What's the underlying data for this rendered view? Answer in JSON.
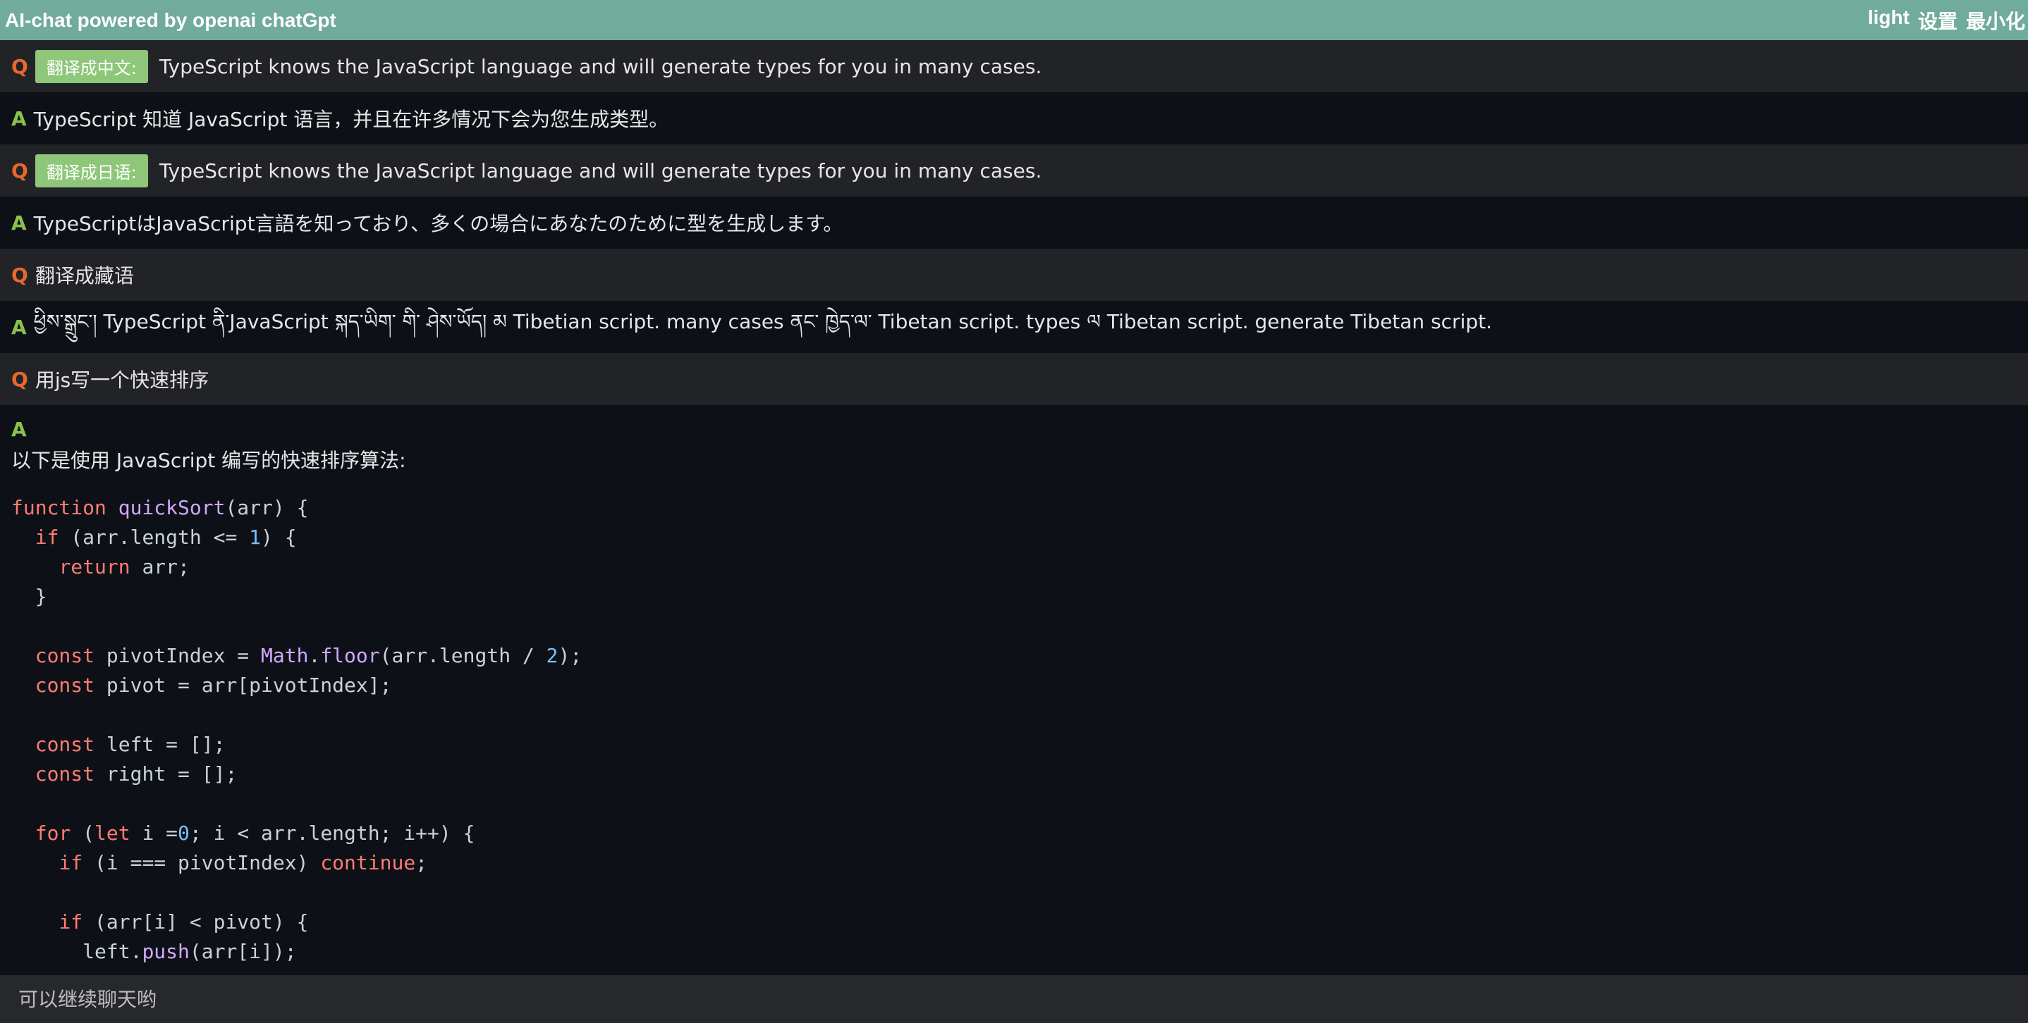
{
  "header": {
    "title": "AI-chat powered by openai chatGpt",
    "actions": [
      "light",
      "设置",
      "最小化"
    ]
  },
  "messages": [
    {
      "role": "Q",
      "tag": "翻译成中文:",
      "text": "TypeScript knows the JavaScript language and will generate types for you in many cases."
    },
    {
      "role": "A",
      "text": "TypeScript 知道 JavaScript 语言，并且在许多情况下会为您生成类型。"
    },
    {
      "role": "Q",
      "tag": "翻译成日语:",
      "text": "TypeScript knows the JavaScript language and will generate types for you in many cases."
    },
    {
      "role": "A",
      "text": "TypeScriptはJavaScript言語を知っており、多くの場合にあなたのために型を生成します。"
    },
    {
      "role": "Q",
      "text": "翻译成藏语"
    },
    {
      "role": "A",
      "text": "ཕྱིས་སྒྲུང་། TypeScript ནི་JavaScript སྐད་ཡིག་ གི་ ཤེས་ཡོད། མ Tibetian script. many cases ནང་ ཁྱེད་ལ་ Tibetan script. types ལ Tibetan script. generate Tibetan script."
    },
    {
      "role": "Q",
      "text": "用js写一个快速排序"
    }
  ],
  "last_answer": {
    "role": "A",
    "intro": "以下是使用 JavaScript 编写的快速排序算法:",
    "code_lines": [
      "function quickSort(arr) {",
      "  if (arr.length <= 1) {",
      "    return arr;",
      "  }",
      "",
      "  const pivotIndex = Math.floor(arr.length / 2);",
      "  const pivot = arr[pivotIndex];",
      "",
      "  const left = [];",
      "  const right = [];",
      "",
      "  for (let i =0; i < arr.length; i++) {",
      "    if (i === pivotIndex) continue;",
      "",
      "    if (arr[i] < pivot) {",
      "      left.push(arr[i]);"
    ]
  },
  "input": {
    "placeholder": "可以继续聊天哟"
  },
  "colors": {
    "titlebar": "#71ab9b",
    "question_marker": "#e8672f",
    "answer_marker": "#8bc34a",
    "tag_bg": "#8ec77a"
  }
}
